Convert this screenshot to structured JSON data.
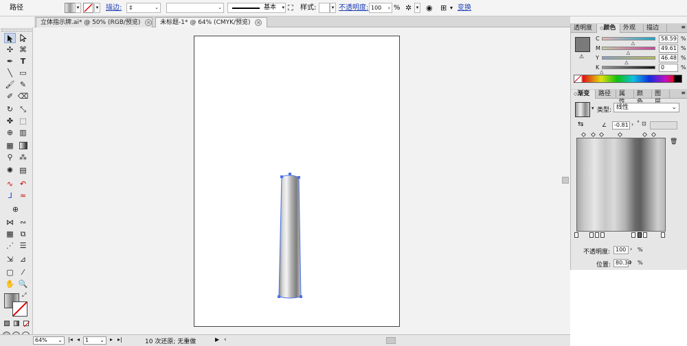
{
  "control_bar": {
    "object_type": "路径",
    "stroke_label": "描边:",
    "stroke_style_label": "基本",
    "style_label": "样式:",
    "opacity_label": "不透明度:",
    "opacity_value": "100",
    "opacity_unit": "%",
    "transform_link": "变换"
  },
  "tabs": [
    {
      "label": "立体指示牌.ai* @ 50% (RGB/预览)",
      "active": false
    },
    {
      "label": "未标题-1* @ 64% (CMYK/预览)",
      "active": true
    }
  ],
  "color_panel": {
    "tabs": [
      "透明度",
      "颜色",
      "外观",
      "描边"
    ],
    "active_tab": "颜色",
    "channels": [
      {
        "label": "C",
        "value": "58.59",
        "fraction": 0.5859
      },
      {
        "label": "M",
        "value": "49.61",
        "fraction": 0.4961
      },
      {
        "label": "Y",
        "value": "46.48",
        "fraction": 0.4648
      },
      {
        "label": "K",
        "value": "0",
        "fraction": 0
      }
    ],
    "unit": "%"
  },
  "gradient_panel": {
    "tabs": [
      "渐变",
      "路径",
      "属性",
      "颜色",
      "图层"
    ],
    "active_tab": "渐变",
    "type_label": "类型:",
    "type_value": "线性",
    "angle_value": "-0.81",
    "angle_unit": "°",
    "opacity_label": "不透明度:",
    "opacity_value": "100",
    "location_label": "位置:",
    "location_value": "80.34",
    "unit": "%"
  },
  "status_bar": {
    "zoom": "64%",
    "page": "1",
    "undo_info": "10 次还原; 无重做"
  },
  "colors": {
    "accent_link": "#1f3fb6",
    "selection": "#4a72e8",
    "fill_swatch": "#7a7a7a"
  }
}
